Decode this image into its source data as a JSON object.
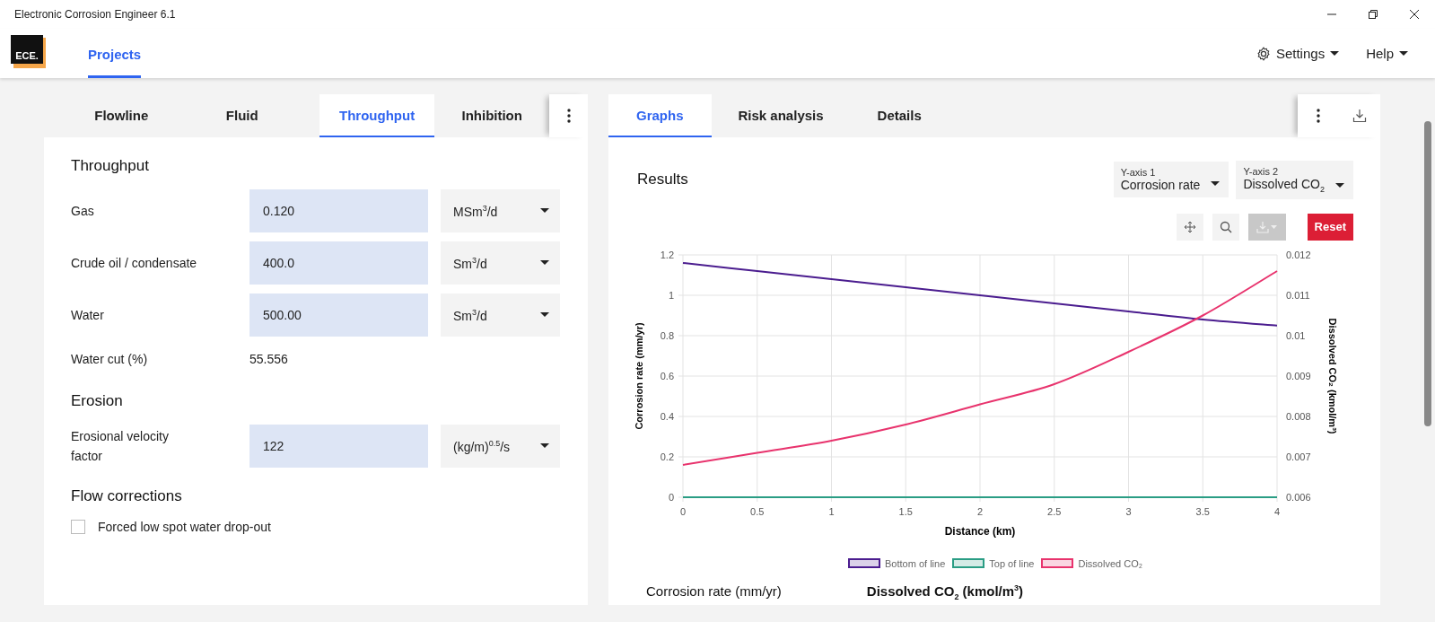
{
  "window": {
    "title": "Electronic Corrosion Engineer 6.1"
  },
  "header": {
    "logo": "ECE.",
    "nav": [
      {
        "label": "Projects",
        "selected": true
      }
    ],
    "menus": [
      {
        "label": "Settings",
        "kind": "settings"
      },
      {
        "label": "Help",
        "kind": "plain"
      }
    ]
  },
  "input_panel": {
    "tabs": [
      {
        "label": "Flowline",
        "selected": false
      },
      {
        "label": "Fluid",
        "selected": false
      },
      {
        "label": "Throughput",
        "selected": true
      },
      {
        "label": "Inhibition",
        "selected": false
      }
    ],
    "sections": [
      {
        "title": "Throughput",
        "rows": [
          {
            "kind": "field",
            "label": "Gas",
            "value": "0.120",
            "unit": "MSm$^{3}$/d"
          },
          {
            "kind": "field",
            "label": "Crude oil / condensate",
            "value": "400.0",
            "unit": "Sm$^{3}$/d"
          },
          {
            "kind": "field",
            "label": "Water",
            "value": "500.00",
            "unit": "Sm$^{3}$/d"
          },
          {
            "kind": "readout",
            "label": "Water cut (%)",
            "value": "55.556"
          }
        ]
      },
      {
        "title": "Erosion",
        "rows": [
          {
            "kind": "field",
            "label": "Erosional velocity factor",
            "value": "122",
            "unit": "(kg/m)$^{0.5}$/s"
          }
        ]
      },
      {
        "title": "Flow corrections",
        "rows": [
          {
            "kind": "checkbox",
            "label": "Forced low spot water drop-out",
            "checked": false
          }
        ]
      }
    ]
  },
  "results_panel": {
    "tabs": [
      {
        "label": "Graphs",
        "selected": true
      },
      {
        "label": "Risk analysis",
        "selected": false
      },
      {
        "label": "Details",
        "selected": false
      }
    ],
    "title": "Results",
    "axis_selectors": [
      {
        "label": "Y-axis 1",
        "value": "Corrosion rate"
      },
      {
        "label": "Y-axis 2",
        "value": "Dissolved CO$_{2}$"
      }
    ],
    "tools": [
      {
        "kind": "pan",
        "disabled": false
      },
      {
        "kind": "zoom",
        "disabled": false
      },
      {
        "kind": "download",
        "disabled": true
      }
    ],
    "reset": "Reset",
    "chart_data": {
      "type": "line",
      "xlabel": "Distance (km)",
      "ylabel": "Corrosion rate (mm/yr)",
      "y2label": "Dissolved CO₂ (kmol/m³)",
      "x": [
        0,
        0.5,
        1,
        1.5,
        2,
        2.5,
        3,
        3.5,
        4
      ],
      "grid": true,
      "xlim": [
        0,
        4
      ],
      "ylim": [
        0,
        1.2
      ],
      "y2lim": [
        0.006,
        0.012
      ],
      "xticks": [
        0,
        0.5,
        1,
        1.5,
        2,
        2.5,
        3,
        3.5,
        4
      ],
      "yticks": [
        0,
        0.2,
        0.4,
        0.6,
        0.8,
        1,
        1.2
      ],
      "y2ticks": [
        0.006,
        0.007,
        0.008,
        0.009,
        0.01,
        0.011,
        0.012
      ],
      "series": [
        {
          "name": "Bottom of line",
          "color": "#4b1d8f",
          "values": [
            1.16,
            1.12,
            1.08,
            1.04,
            1.0,
            0.96,
            0.92,
            0.88,
            0.85
          ]
        },
        {
          "name": "Top of line",
          "color": "#2a9d84",
          "values": [
            0,
            0,
            0,
            0,
            0,
            0,
            0,
            0,
            0
          ]
        },
        {
          "name": "Dissolved CO₂",
          "color": "#e8336d",
          "axis": "y2",
          "values": [
            0.0068,
            0.0071,
            0.0074,
            0.0078,
            0.0083,
            0.0088,
            0.0096,
            0.0105,
            0.0116
          ]
        }
      ]
    },
    "summary_headings": [
      "Corrosion rate (mm/yr)",
      "Dissolved CO$_{2}$ (kmol/m$^{3}$)"
    ]
  }
}
